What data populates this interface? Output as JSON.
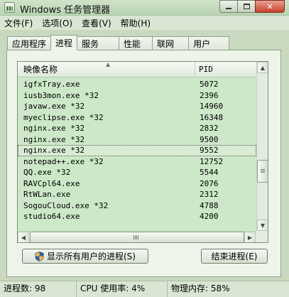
{
  "window": {
    "title": "Windows 任务管理器"
  },
  "menu": [
    "文件(F)",
    "选项(O)",
    "查看(V)",
    "帮助(H)"
  ],
  "tabs": [
    "应用程序",
    "进程",
    "服务",
    "性能",
    "联网",
    "用户"
  ],
  "active_tab": "进程",
  "list": {
    "columns": {
      "name": "映像名称",
      "pid": "PID"
    },
    "rows": [
      {
        "name": "igfxTray.exe",
        "pid": "5072"
      },
      {
        "name": "iusb3mon.exe *32",
        "pid": "2396"
      },
      {
        "name": "javaw.exe *32",
        "pid": "14960"
      },
      {
        "name": "myeclipse.exe *32",
        "pid": "16348"
      },
      {
        "name": "nginx.exe *32",
        "pid": "2832"
      },
      {
        "name": "nginx.exe *32",
        "pid": "9500"
      },
      {
        "name": "nginx.exe *32",
        "pid": "9552",
        "selected": true
      },
      {
        "name": "notepad++.exe *32",
        "pid": "12752"
      },
      {
        "name": "QQ.exe *32",
        "pid": "5544"
      },
      {
        "name": "RAVCpl64.exe",
        "pid": "2076"
      },
      {
        "name": "RtWLan.exe",
        "pid": "2312"
      },
      {
        "name": "SogouCloud.exe *32",
        "pid": "4788"
      },
      {
        "name": "studio64.exe",
        "pid": "4200"
      }
    ]
  },
  "buttons": {
    "show_all": "显示所有用户的进程(S)",
    "end_process": "结束进程(E)"
  },
  "status": {
    "processes": "进程数: 98",
    "cpu": "CPU 使用率: 4%",
    "memory": "物理内存: 58%"
  }
}
